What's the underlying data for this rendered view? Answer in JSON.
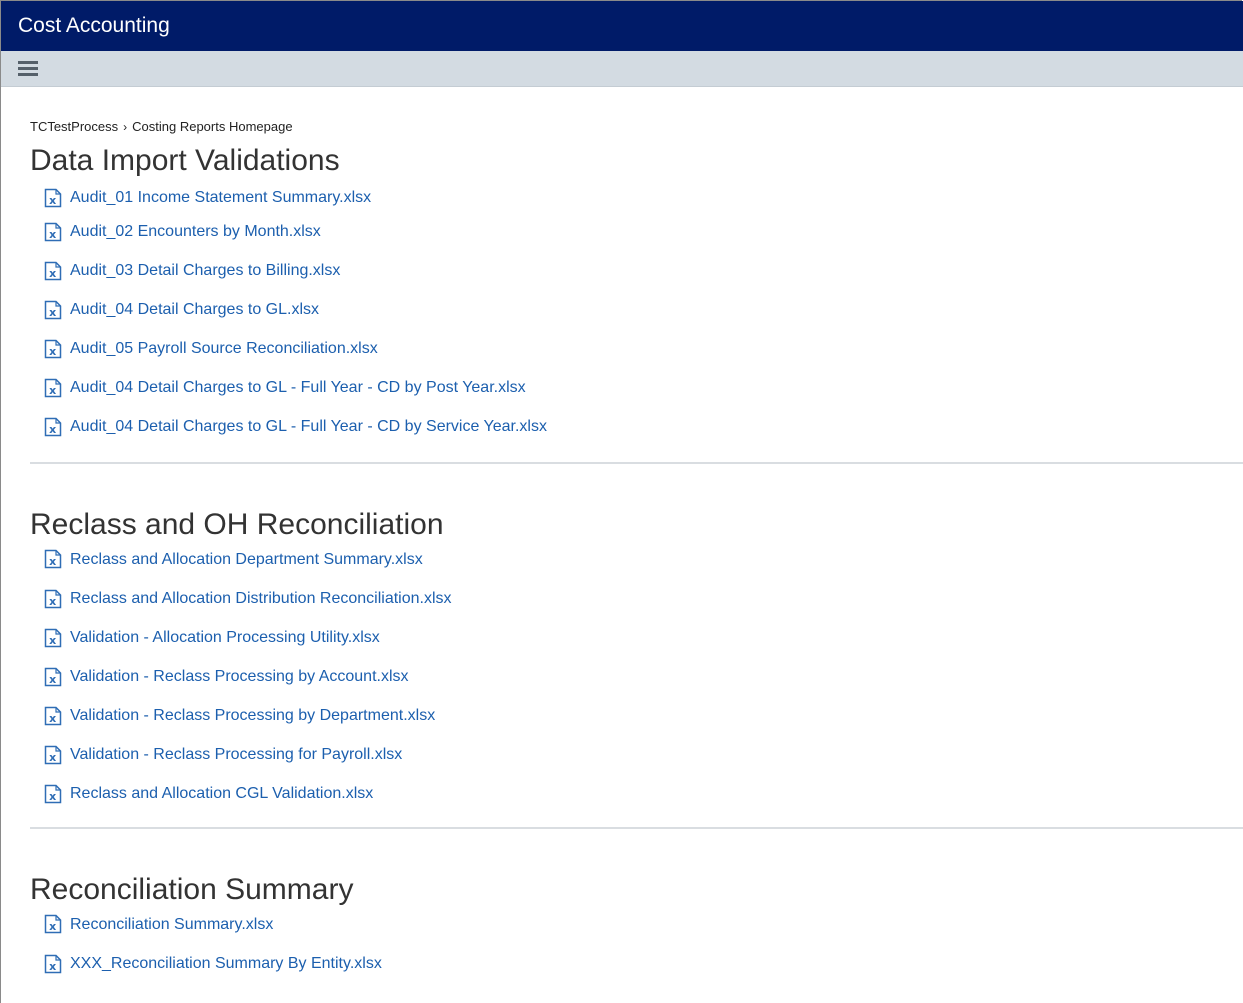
{
  "app": {
    "title": "Cost Accounting"
  },
  "toolbar": {
    "menu_icon": "hamburger-menu-icon"
  },
  "breadcrumb": {
    "root": "TCTestProcess",
    "separator": "›",
    "current": "Costing Reports Homepage"
  },
  "sections": [
    {
      "title": "Data Import Validations",
      "files": [
        "Audit_01 Income Statement Summary.xlsx",
        "Audit_02 Encounters by Month.xlsx",
        "Audit_03 Detail Charges to Billing.xlsx",
        "Audit_04 Detail Charges to GL.xlsx",
        "Audit_05 Payroll Source Reconciliation.xlsx",
        "Audit_04 Detail Charges to GL - Full Year - CD by Post Year.xlsx",
        "Audit_04 Detail Charges to GL - Full Year - CD by Service Year.xlsx"
      ]
    },
    {
      "title": "Reclass and OH Reconciliation",
      "files": [
        "Reclass and Allocation Department Summary.xlsx",
        "Reclass and Allocation Distribution Reconciliation.xlsx",
        "Validation - Allocation Processing Utility.xlsx",
        "Validation - Reclass Processing by Account.xlsx",
        "Validation - Reclass Processing by Department.xlsx",
        "Validation - Reclass Processing for Payroll.xlsx",
        "Reclass and Allocation CGL Validation.xlsx"
      ]
    },
    {
      "title": "Reconciliation Summary",
      "files": [
        "Reconciliation Summary.xlsx",
        "XXX_Reconciliation Summary By Entity.xlsx"
      ]
    }
  ],
  "colors": {
    "titlebar": "#001b68",
    "toolbar": "#d3dbe2",
    "link": "#1c5fae"
  },
  "icons": {
    "file": "excel-file-icon"
  }
}
